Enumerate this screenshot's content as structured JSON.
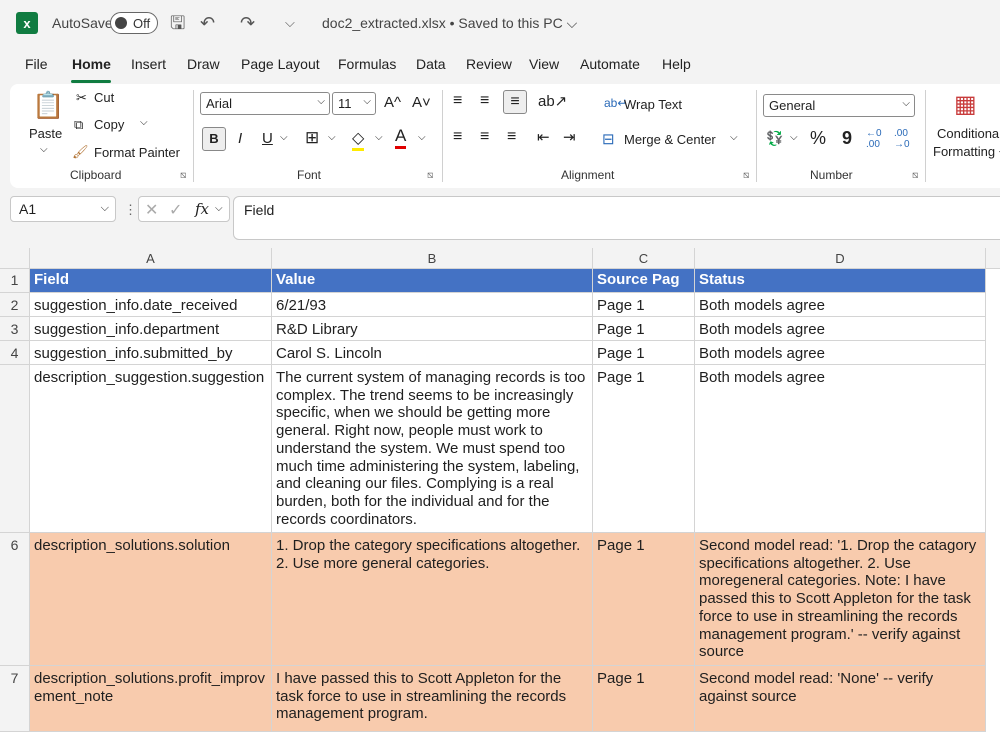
{
  "titlebar": {
    "autosave_label": "AutoSave",
    "toggle_label": "Off",
    "filename": "doc2_extracted.xlsx • Saved to this PC ⌵"
  },
  "menu": [
    "File",
    "Home",
    "Insert",
    "Draw",
    "Page Layout",
    "Formulas",
    "Data",
    "Review",
    "View",
    "Automate",
    "Help"
  ],
  "ribbon": {
    "clipboard": {
      "paste": "Paste",
      "cut": "Cut",
      "copy": "Copy",
      "format_painter": "Format Painter",
      "label": "Clipboard"
    },
    "font": {
      "name": "Arial",
      "size": "11",
      "grow": "A^",
      "shrink": "A˅",
      "bold": "B",
      "italic": "I",
      "underline": "U",
      "label": "Font"
    },
    "alignment": {
      "wrap_text": "Wrap Text",
      "merge_center": "Merge & Center",
      "label": "Alignment"
    },
    "number": {
      "format": "General",
      "percent": "%",
      "comma": "9",
      "label": "Number"
    },
    "styles": {
      "conditional": "Conditional",
      "formatting": "Formatting ⌵"
    }
  },
  "formula_bar": {
    "name_box": "A1",
    "fx": "fx",
    "content": "Field"
  },
  "columns": [
    "A",
    "B",
    "C",
    "D"
  ],
  "rows": [
    {
      "num": "1",
      "cells": [
        "Field",
        "Value",
        "Source Pag",
        "Status"
      ]
    },
    {
      "num": "2",
      "cells": [
        "suggestion_info.date_received",
        "6/21/93",
        "Page 1",
        "Both models agree"
      ]
    },
    {
      "num": "3",
      "cells": [
        "suggestion_info.department",
        "R&D Library",
        "Page 1",
        "Both models agree"
      ]
    },
    {
      "num": "4",
      "cells": [
        "suggestion_info.submitted_by",
        "Carol S. Lincoln",
        "Page 1",
        "Both models agree"
      ]
    },
    {
      "num": "",
      "cells": [
        "description_suggestion.suggestion",
        "The current system of managing records is too complex. The trend seems to be increasingly specific, when we should be getting more general. Right now, people must work to understand the system. We must spend too much time administering the system, labeling, and cleaning our files. Complying is a real burden, both for the individual and for the records coordinators.",
        "Page 1",
        "Both models agree"
      ]
    },
    {
      "num": "6",
      "cells": [
        "description_solutions.solution",
        "1. Drop the category specifications altogether.\n2. Use more general categories.",
        "Page 1",
        "Second model read: '1. Drop the catagory specifications altogether. 2. Use moregeneral categories. Note: I have passed this to Scott Appleton for the task force to use in streamlining the records management program.' -- verify against source"
      ]
    },
    {
      "num": "7",
      "cells": [
        "description_solutions.profit_improvement_note",
        "I have passed this to Scott Appleton for the task force to use in streamlining the records management program.",
        "Page 1",
        "Second model read: 'None' -- verify against source"
      ]
    }
  ]
}
